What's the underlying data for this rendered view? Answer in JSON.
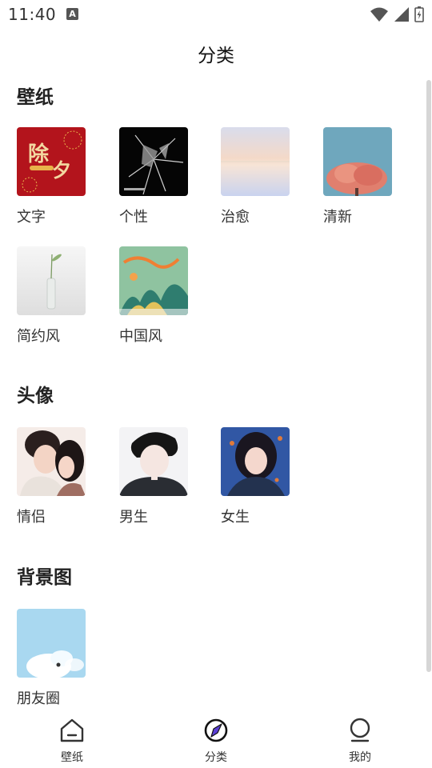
{
  "status_bar": {
    "time": "11:40",
    "notification_glyph": "A"
  },
  "header": {
    "title": "分类"
  },
  "sections": [
    {
      "title": "壁纸",
      "items": [
        "文字",
        "个性",
        "治愈",
        "清新",
        "简约风",
        "中国风"
      ]
    },
    {
      "title": "头像",
      "items": [
        "情侣",
        "男生",
        "女生"
      ]
    },
    {
      "title": "背景图",
      "items": [
        "朋友圈"
      ]
    }
  ],
  "bottom_nav": [
    {
      "label": "壁纸",
      "icon": "home-icon"
    },
    {
      "label": "分类",
      "icon": "compass-icon",
      "active": true
    },
    {
      "label": "我的",
      "icon": "profile-icon"
    }
  ],
  "colors": {
    "accent": "#5b3fd6",
    "text": "#333333"
  }
}
